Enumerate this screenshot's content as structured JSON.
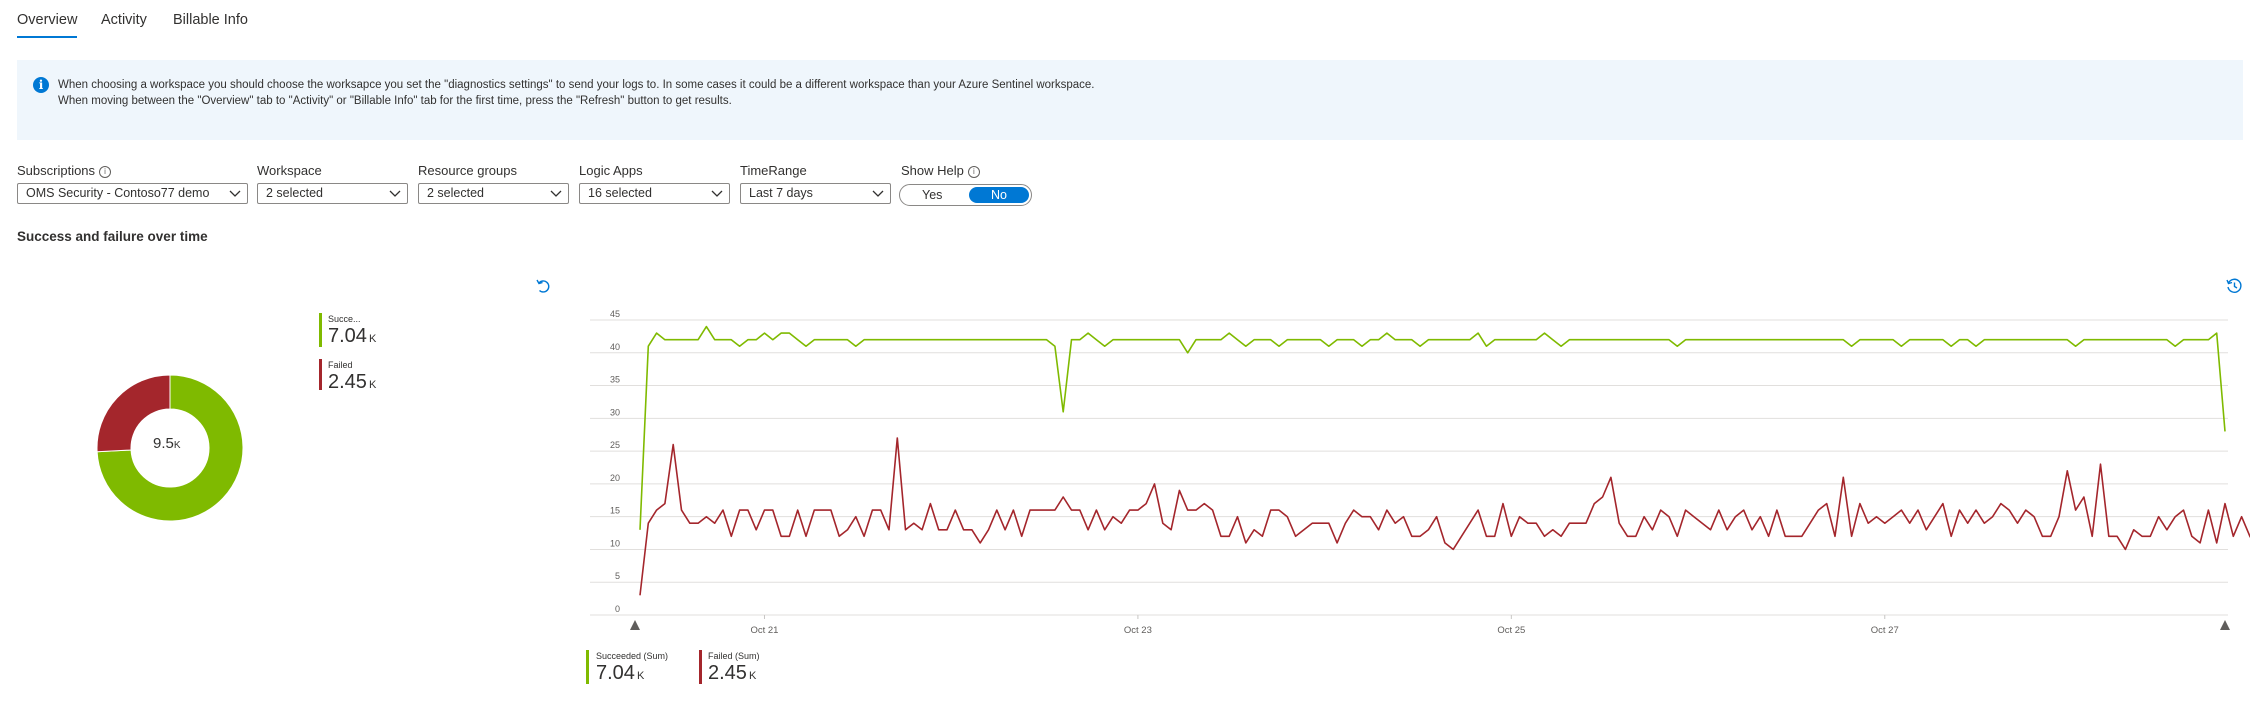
{
  "tabs": [
    {
      "label": "Overview",
      "active": true
    },
    {
      "label": "Activity",
      "active": false
    },
    {
      "label": "Billable Info",
      "active": false
    }
  ],
  "info": {
    "icon": "info-icon",
    "line1": "When choosing a workspace you should choose the worksapce you set the \"diagnostics settings\" to send your logs to. In some cases it could be a different workspace than your Azure Sentinel workspace.",
    "line2": "When moving between the \"Overview\" tab to \"Activity\" or \"Billable Info\" tab for the first time, press the \"Refresh\" button to get results."
  },
  "filters": {
    "subscriptions": {
      "label": "Subscriptions",
      "value": "OMS Security - Contoso77 demo"
    },
    "workspace": {
      "label": "Workspace",
      "value": "2 selected"
    },
    "resource_groups": {
      "label": "Resource groups",
      "value": "2 selected"
    },
    "logic_apps": {
      "label": "Logic Apps",
      "value": "16 selected"
    },
    "time_range": {
      "label": "TimeRange",
      "value": "Last 7 days"
    },
    "show_help": {
      "label": "Show Help",
      "yes": "Yes",
      "no": "No",
      "selected": "No"
    }
  },
  "section_title": "Success and failure over time",
  "donut": {
    "center_value": "9.5",
    "center_unit": "K",
    "legend": [
      {
        "name": "Succe...",
        "value": "7.04",
        "unit": "K",
        "color": "#7fba00"
      },
      {
        "name": "Failed",
        "value": "2.45",
        "unit": "K",
        "color": "#a4262c"
      }
    ]
  },
  "chart_legend": [
    {
      "name": "Succeeded (Sum)",
      "value": "7.04",
      "unit": "K",
      "color": "#7fba00"
    },
    {
      "name": "Failed (Sum)",
      "value": "2.45",
      "unit": "K",
      "color": "#a4262c"
    }
  ],
  "icons": {
    "undo": "undo-icon",
    "history": "history-icon"
  },
  "chart_data": [
    {
      "type": "pie",
      "categories": [
        "Succeeded",
        "Failed"
      ],
      "values": [
        7040,
        2450
      ],
      "colors": [
        "#7fba00",
        "#a4262c"
      ],
      "center_label": "9.5K"
    },
    {
      "type": "line",
      "yticks": [
        0,
        5,
        10,
        15,
        20,
        25,
        30,
        35,
        40,
        45
      ],
      "xtick_labels": [
        "Oct 21",
        "Oct 23",
        "Oct 25",
        "Oct 27"
      ],
      "grid": true,
      "ylim": [
        0,
        45
      ],
      "series": [
        {
          "name": "Succeeded (Sum)",
          "color": "#7fba00",
          "values": [
            13,
            41,
            43,
            42,
            42,
            42,
            42,
            42,
            44,
            42,
            42,
            42,
            41,
            42,
            42,
            43,
            42,
            43,
            43,
            42,
            41,
            42,
            42,
            42,
            42,
            42,
            41,
            42,
            42,
            42,
            42,
            42,
            42,
            42,
            42,
            42,
            42,
            42,
            42,
            42,
            42,
            42,
            42,
            42,
            42,
            42,
            42,
            42,
            42,
            42,
            41,
            31,
            42,
            42,
            43,
            42,
            41,
            42,
            42,
            42,
            42,
            42,
            42,
            42,
            42,
            42,
            40,
            42,
            42,
            42,
            42,
            43,
            42,
            41,
            42,
            42,
            42,
            41,
            42,
            42,
            42,
            42,
            42,
            41,
            42,
            42,
            42,
            41,
            42,
            42,
            43,
            42,
            42,
            42,
            41,
            42,
            42,
            42,
            42,
            42,
            42,
            43,
            41,
            42,
            42,
            42,
            42,
            42,
            42,
            43,
            42,
            41,
            42,
            42,
            42,
            42,
            42,
            42,
            42,
            42,
            42,
            42,
            42,
            42,
            42,
            41,
            42,
            42,
            42,
            42,
            42,
            42,
            42,
            42,
            42,
            42,
            42,
            42,
            42,
            42,
            42,
            42,
            42,
            42,
            42,
            42,
            41,
            42,
            42,
            42,
            42,
            42,
            41,
            42,
            42,
            42,
            42,
            42,
            41,
            42,
            42,
            41,
            42,
            42,
            42,
            42,
            42,
            42,
            42,
            42,
            42,
            42,
            42,
            41,
            42,
            42,
            42,
            42,
            42,
            42,
            42,
            42,
            42,
            42,
            42,
            41,
            42,
            42,
            42,
            42,
            43,
            28
          ]
        },
        {
          "name": "Failed (Sum)",
          "color": "#a4262c",
          "values": [
            3,
            14,
            16,
            17,
            26,
            16,
            14,
            14,
            15,
            14,
            16,
            12,
            16,
            16,
            13,
            16,
            16,
            12,
            12,
            16,
            12,
            16,
            16,
            16,
            12,
            13,
            15,
            12,
            16,
            16,
            13,
            27,
            13,
            14,
            13,
            17,
            13,
            13,
            16,
            13,
            13,
            11,
            13,
            16,
            13,
            16,
            12,
            16,
            16,
            16,
            16,
            18,
            16,
            16,
            13,
            16,
            13,
            15,
            14,
            16,
            16,
            17,
            20,
            14,
            13,
            19,
            16,
            16,
            17,
            16,
            12,
            12,
            15,
            11,
            13,
            12,
            16,
            16,
            15,
            12,
            13,
            14,
            14,
            14,
            11,
            14,
            16,
            15,
            15,
            13,
            16,
            14,
            15,
            12,
            12,
            13,
            15,
            11,
            10,
            12,
            14,
            16,
            12,
            12,
            17,
            12,
            15,
            14,
            14,
            12,
            13,
            12,
            14,
            14,
            14,
            17,
            18,
            21,
            14,
            12,
            12,
            15,
            13,
            16,
            15,
            12,
            16,
            15,
            14,
            13,
            16,
            13,
            15,
            16,
            13,
            15,
            12,
            16,
            12,
            12,
            12,
            14,
            16,
            17,
            12,
            21,
            12,
            17,
            14,
            15,
            14,
            15,
            16,
            14,
            16,
            13,
            15,
            17,
            12,
            16,
            14,
            16,
            14,
            15,
            17,
            16,
            14,
            16,
            15,
            12,
            12,
            15,
            22,
            16,
            18,
            12,
            23,
            12,
            12,
            10,
            13,
            12,
            12,
            15,
            13,
            15,
            16,
            12,
            11,
            16,
            11,
            17,
            12,
            15,
            12,
            10
          ]
        }
      ]
    }
  ]
}
